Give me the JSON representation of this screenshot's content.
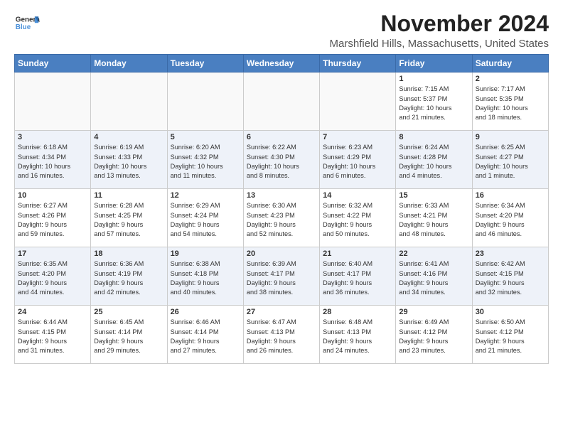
{
  "header": {
    "logo_general": "General",
    "logo_blue": "Blue",
    "month": "November 2024",
    "location": "Marshfield Hills, Massachusetts, United States"
  },
  "weekdays": [
    "Sunday",
    "Monday",
    "Tuesday",
    "Wednesday",
    "Thursday",
    "Friday",
    "Saturday"
  ],
  "weeks": [
    [
      {
        "day": "",
        "info": ""
      },
      {
        "day": "",
        "info": ""
      },
      {
        "day": "",
        "info": ""
      },
      {
        "day": "",
        "info": ""
      },
      {
        "day": "",
        "info": ""
      },
      {
        "day": "1",
        "info": "Sunrise: 7:15 AM\nSunset: 5:37 PM\nDaylight: 10 hours\nand 21 minutes."
      },
      {
        "day": "2",
        "info": "Sunrise: 7:17 AM\nSunset: 5:35 PM\nDaylight: 10 hours\nand 18 minutes."
      }
    ],
    [
      {
        "day": "3",
        "info": "Sunrise: 6:18 AM\nSunset: 4:34 PM\nDaylight: 10 hours\nand 16 minutes."
      },
      {
        "day": "4",
        "info": "Sunrise: 6:19 AM\nSunset: 4:33 PM\nDaylight: 10 hours\nand 13 minutes."
      },
      {
        "day": "5",
        "info": "Sunrise: 6:20 AM\nSunset: 4:32 PM\nDaylight: 10 hours\nand 11 minutes."
      },
      {
        "day": "6",
        "info": "Sunrise: 6:22 AM\nSunset: 4:30 PM\nDaylight: 10 hours\nand 8 minutes."
      },
      {
        "day": "7",
        "info": "Sunrise: 6:23 AM\nSunset: 4:29 PM\nDaylight: 10 hours\nand 6 minutes."
      },
      {
        "day": "8",
        "info": "Sunrise: 6:24 AM\nSunset: 4:28 PM\nDaylight: 10 hours\nand 4 minutes."
      },
      {
        "day": "9",
        "info": "Sunrise: 6:25 AM\nSunset: 4:27 PM\nDaylight: 10 hours\nand 1 minute."
      }
    ],
    [
      {
        "day": "10",
        "info": "Sunrise: 6:27 AM\nSunset: 4:26 PM\nDaylight: 9 hours\nand 59 minutes."
      },
      {
        "day": "11",
        "info": "Sunrise: 6:28 AM\nSunset: 4:25 PM\nDaylight: 9 hours\nand 57 minutes."
      },
      {
        "day": "12",
        "info": "Sunrise: 6:29 AM\nSunset: 4:24 PM\nDaylight: 9 hours\nand 54 minutes."
      },
      {
        "day": "13",
        "info": "Sunrise: 6:30 AM\nSunset: 4:23 PM\nDaylight: 9 hours\nand 52 minutes."
      },
      {
        "day": "14",
        "info": "Sunrise: 6:32 AM\nSunset: 4:22 PM\nDaylight: 9 hours\nand 50 minutes."
      },
      {
        "day": "15",
        "info": "Sunrise: 6:33 AM\nSunset: 4:21 PM\nDaylight: 9 hours\nand 48 minutes."
      },
      {
        "day": "16",
        "info": "Sunrise: 6:34 AM\nSunset: 4:20 PM\nDaylight: 9 hours\nand 46 minutes."
      }
    ],
    [
      {
        "day": "17",
        "info": "Sunrise: 6:35 AM\nSunset: 4:20 PM\nDaylight: 9 hours\nand 44 minutes."
      },
      {
        "day": "18",
        "info": "Sunrise: 6:36 AM\nSunset: 4:19 PM\nDaylight: 9 hours\nand 42 minutes."
      },
      {
        "day": "19",
        "info": "Sunrise: 6:38 AM\nSunset: 4:18 PM\nDaylight: 9 hours\nand 40 minutes."
      },
      {
        "day": "20",
        "info": "Sunrise: 6:39 AM\nSunset: 4:17 PM\nDaylight: 9 hours\nand 38 minutes."
      },
      {
        "day": "21",
        "info": "Sunrise: 6:40 AM\nSunset: 4:17 PM\nDaylight: 9 hours\nand 36 minutes."
      },
      {
        "day": "22",
        "info": "Sunrise: 6:41 AM\nSunset: 4:16 PM\nDaylight: 9 hours\nand 34 minutes."
      },
      {
        "day": "23",
        "info": "Sunrise: 6:42 AM\nSunset: 4:15 PM\nDaylight: 9 hours\nand 32 minutes."
      }
    ],
    [
      {
        "day": "24",
        "info": "Sunrise: 6:44 AM\nSunset: 4:15 PM\nDaylight: 9 hours\nand 31 minutes."
      },
      {
        "day": "25",
        "info": "Sunrise: 6:45 AM\nSunset: 4:14 PM\nDaylight: 9 hours\nand 29 minutes."
      },
      {
        "day": "26",
        "info": "Sunrise: 6:46 AM\nSunset: 4:14 PM\nDaylight: 9 hours\nand 27 minutes."
      },
      {
        "day": "27",
        "info": "Sunrise: 6:47 AM\nSunset: 4:13 PM\nDaylight: 9 hours\nand 26 minutes."
      },
      {
        "day": "28",
        "info": "Sunrise: 6:48 AM\nSunset: 4:13 PM\nDaylight: 9 hours\nand 24 minutes."
      },
      {
        "day": "29",
        "info": "Sunrise: 6:49 AM\nSunset: 4:12 PM\nDaylight: 9 hours\nand 23 minutes."
      },
      {
        "day": "30",
        "info": "Sunrise: 6:50 AM\nSunset: 4:12 PM\nDaylight: 9 hours\nand 21 minutes."
      }
    ]
  ]
}
